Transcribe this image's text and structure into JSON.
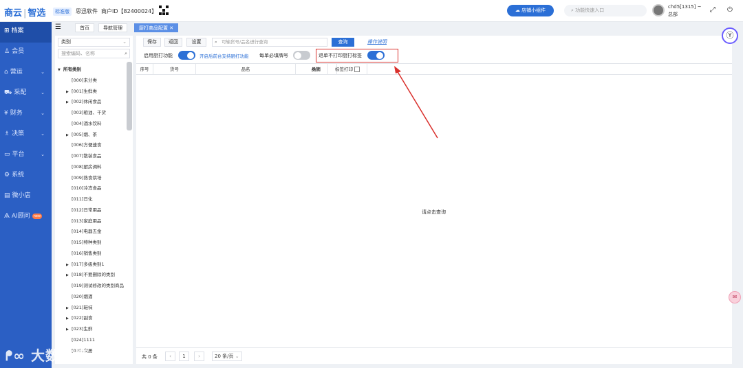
{
  "header": {
    "logo_left": "商云",
    "logo_right": "智选",
    "edition": "标准版",
    "company": "思迅软件",
    "merchant": "商户ID【82400024】",
    "widget_button": "店铺小组件",
    "search_placeholder": "功能快速入口",
    "user_name": "chd5[1315] ~",
    "user_role": "总部"
  },
  "sidebar": {
    "items": [
      {
        "icon": "archive-icon",
        "glyph": "⊞",
        "label": "档案",
        "active": true
      },
      {
        "icon": "member-icon",
        "glyph": "♙",
        "label": "会员"
      },
      {
        "icon": "operation-icon",
        "glyph": "⌂",
        "label": "营运",
        "chevron": true
      },
      {
        "icon": "purchase-icon",
        "glyph": "⛟",
        "label": "采配",
        "chevron": true
      },
      {
        "icon": "finance-icon",
        "glyph": "¥",
        "label": "财务",
        "chevron": true
      },
      {
        "icon": "decision-icon",
        "glyph": "♗",
        "label": "决策",
        "chevron": true
      },
      {
        "icon": "platform-icon",
        "glyph": "▭",
        "label": "平台",
        "chevron": true
      },
      {
        "icon": "system-icon",
        "glyph": "⚙",
        "label": "系统"
      },
      {
        "icon": "mini-store-icon",
        "glyph": "▤",
        "label": "微小店"
      },
      {
        "icon": "ai-icon",
        "glyph": "Ѧ",
        "label": "AI顾问",
        "badge": "new"
      }
    ]
  },
  "tabs": [
    {
      "label": "首页"
    },
    {
      "label": "导航管理"
    },
    {
      "label": "厨打商品配置",
      "active": true
    }
  ],
  "category_panel": {
    "select_value": "类别",
    "search_placeholder": "搜索编码、名称",
    "tree": [
      {
        "label": "所有类别",
        "root": true
      },
      {
        "label": "[000]未分类"
      },
      {
        "label": "[001]生鲜类",
        "expandable": true
      },
      {
        "label": "[002]休闲食品",
        "expandable": true
      },
      {
        "label": "[003]粮油、干货"
      },
      {
        "label": "[004]酒水饮料"
      },
      {
        "label": "[005]烟、茶",
        "expandable": true
      },
      {
        "label": "[006]方便速食"
      },
      {
        "label": "[007]散装食品"
      },
      {
        "label": "[008]厨房调料"
      },
      {
        "label": "[009]熟食烘培"
      },
      {
        "label": "[010]冷冻食品"
      },
      {
        "label": "[011]日化"
      },
      {
        "label": "[012]日常用品"
      },
      {
        "label": "[013]家庭用品"
      },
      {
        "label": "[014]电器五金"
      },
      {
        "label": "[015]特种类别"
      },
      {
        "label": "[016]销售类别"
      },
      {
        "label": "[017]多级类别1",
        "expandable": true
      },
      {
        "label": "[018]不要删除的类别",
        "expandable": true
      },
      {
        "label": "[019]测试修改的类别商品"
      },
      {
        "label": "[020]烟酒"
      },
      {
        "label": "[021]鞋袜",
        "expandable": true
      },
      {
        "label": "[022]副食",
        "expandable": true
      },
      {
        "label": "[023]生鲜",
        "expandable": true
      },
      {
        "label": "[024]1111"
      },
      {
        "label": "[025]家居"
      }
    ]
  },
  "toolbar": {
    "save": "保存",
    "back": "返回",
    "settings": "设置",
    "search_placeholder": "可输货号/品名进行查询",
    "query": "查询",
    "help": "操作说明"
  },
  "options": {
    "enable_kitchen_print": "启用厨打功能",
    "enable_kitchen_print_on": true,
    "front_desk_link": "开启后前台支持厨打功能",
    "must_table_no": "每单必填牌号",
    "must_table_no_on": false,
    "refund_no_print": "退单不打印厨打标签",
    "refund_no_print_on": true
  },
  "table": {
    "columns": [
      "序号",
      "货号",
      "品名",
      "类别",
      "品牌",
      "标签打印"
    ],
    "empty_message": "请点击查询"
  },
  "pager": {
    "total": "共 0 条",
    "page": "1",
    "page_size": "20 条/页"
  },
  "watermark": "大数跨境",
  "colors": {
    "accent": "#2b6fd6",
    "sidebar": "#2b5fc4",
    "annotation": "#d9302c"
  }
}
